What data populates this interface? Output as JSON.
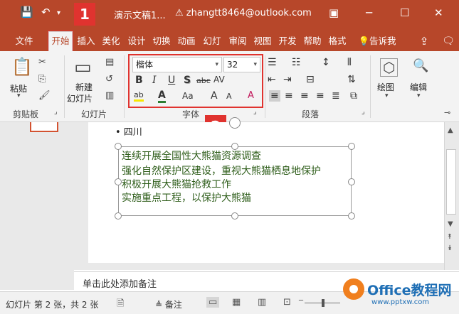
{
  "titlebar": {
    "save_icon": "💾",
    "undo_icon": "↶",
    "undo_dd": "▾",
    "doc_title": "演示文稿1...",
    "warning_icon": "⚠",
    "account": "zhangtt8464@outlook.com",
    "ribbon_display_icon": "▣",
    "minimize": "─",
    "restore": "☐",
    "close": "✕",
    "accent": "#b7472a"
  },
  "tabs": [
    {
      "label": "文件"
    },
    {
      "label": "开始"
    },
    {
      "label": "插入"
    },
    {
      "label": "美化"
    },
    {
      "label": "设计"
    },
    {
      "label": "切换"
    },
    {
      "label": "动画"
    },
    {
      "label": "幻灯"
    },
    {
      "label": "审阅"
    },
    {
      "label": "视图"
    },
    {
      "label": "开发"
    },
    {
      "label": "帮助"
    },
    {
      "label": "格式"
    },
    {
      "label": "告诉我"
    }
  ],
  "tell_me_icon": "💡",
  "share_icon": "⇪",
  "comment_icon": "🗨",
  "callouts": {
    "one": "1",
    "two": "2",
    "color": "#e0332f"
  },
  "ribbon": {
    "clipboard": {
      "paste_icon": "📋",
      "paste_label": "粘贴",
      "paste_dd": "▾",
      "cut_icon": "✂",
      "copy_icon": "⎘",
      "painter_icon": "🖌",
      "group": "剪贴板",
      "launcher": "⌟"
    },
    "slides": {
      "new_icon": "▭",
      "new_label_1": "新建",
      "new_label_2": "幻灯片",
      "layout_icon": "▤",
      "reset_icon": "↺",
      "section_icon": "▥",
      "group": "幻灯片"
    },
    "font": {
      "font_name": "楷体",
      "font_size": "32",
      "dd": "▾",
      "bold": "B",
      "italic": "I",
      "underline": "U",
      "shadow": "S",
      "strike": "abc",
      "spacing": "AV",
      "highlight": "ab",
      "font_color": "A",
      "case": "Aa",
      "grow": "A",
      "shrink": "A",
      "clear": "A",
      "group": "字体",
      "launcher": "⌟"
    },
    "paragraph": {
      "bullets": "☰",
      "numbering": "☷",
      "line_spacing": "↕",
      "columns": "⫴",
      "indent_dec": "⇤",
      "indent_inc": "⇥",
      "direction": "⇅",
      "align_text": "⊟",
      "align_left": "≡",
      "center": "≡",
      "align_right": "≡",
      "justify": "≡",
      "distribute": "≣",
      "smartart": "⧉",
      "group": "段落",
      "launcher": "⌟"
    },
    "drawing": {
      "icon": "⬡",
      "label": "绘图",
      "dd": "▾"
    },
    "editing": {
      "icon": "🔍",
      "label": "编辑",
      "dd": "▾"
    },
    "collapse": "⊸"
  },
  "slide": {
    "bullet_top": "• 四川",
    "lines": [
      "连续开展全国性大熊猫资源调查",
      "强化自然保护区建设，重视大熊猫栖息地保护",
      "积极开展大熊猫抢救工作",
      "实施重点工程，以保护大熊猫"
    ],
    "text_color": "#2e5d1a"
  },
  "scroll": {
    "up": "▲",
    "down": "▼",
    "prev": "⯭",
    "next": "⯯"
  },
  "notes": {
    "placeholder": "单击此处添加备注"
  },
  "status": {
    "slide_info": "幻灯片 第 2 张，共 2 张",
    "spell_icon": "🗎",
    "notes_icon": "≜",
    "notes_label": "备注",
    "view_normal": "▭",
    "view_sorter": "▦",
    "view_reading": "▥",
    "view_show": "⊡",
    "zoom_minus": "─"
  },
  "watermark": {
    "brand": "Office教程网",
    "url": "www.pptxw.com",
    "color": "#1f6fb5"
  }
}
